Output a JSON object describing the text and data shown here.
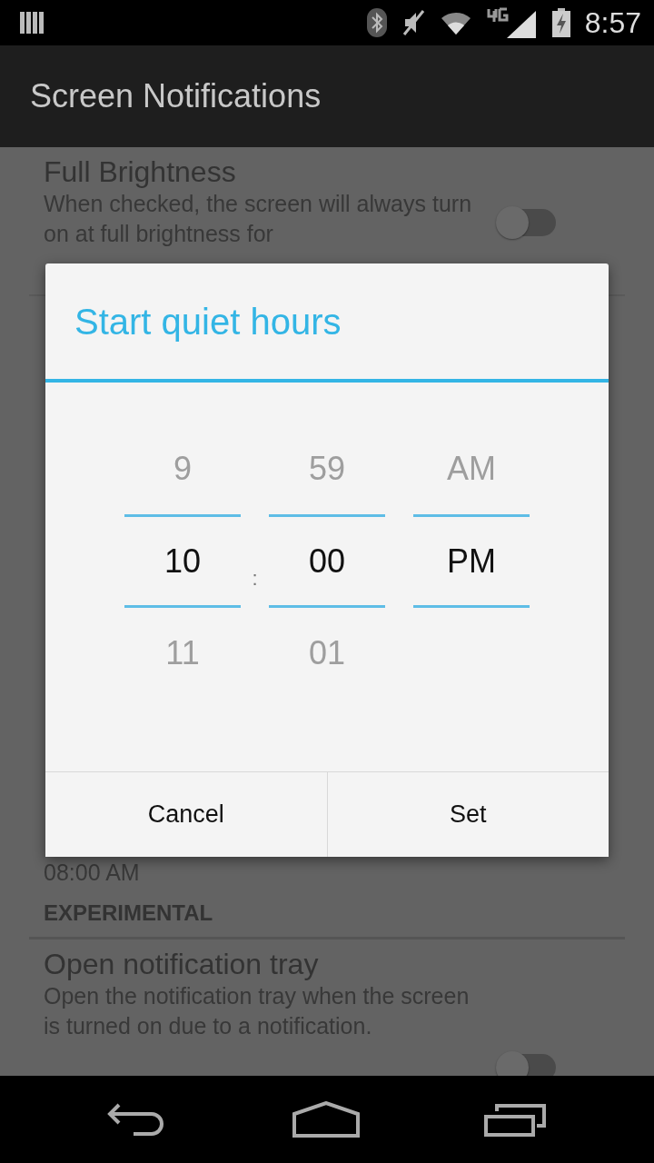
{
  "status_bar": {
    "time": "8:57"
  },
  "app_bar": {
    "title": "Screen Notifications"
  },
  "settings": [
    {
      "kind": "toggle",
      "title": "Full Brightness",
      "summary": "When checked, the screen will always turn on at full brightness for",
      "checked": false
    },
    {
      "kind": "value",
      "summary": "08:00 AM"
    },
    {
      "kind": "header",
      "title": "EXPERIMENTAL"
    },
    {
      "kind": "toggle",
      "title": "Open notification tray",
      "summary": "Open the notification tray when the screen is turned on due to a notification.",
      "checked": false
    }
  ],
  "dialog": {
    "title": "Start quiet hours",
    "separator": ":",
    "columns": [
      {
        "above": "9",
        "value": "10",
        "below": "11"
      },
      {
        "above": "59",
        "value": "00",
        "below": "01"
      },
      {
        "above": "AM",
        "value": "PM"
      }
    ],
    "buttons": [
      "Cancel",
      "Set"
    ]
  }
}
